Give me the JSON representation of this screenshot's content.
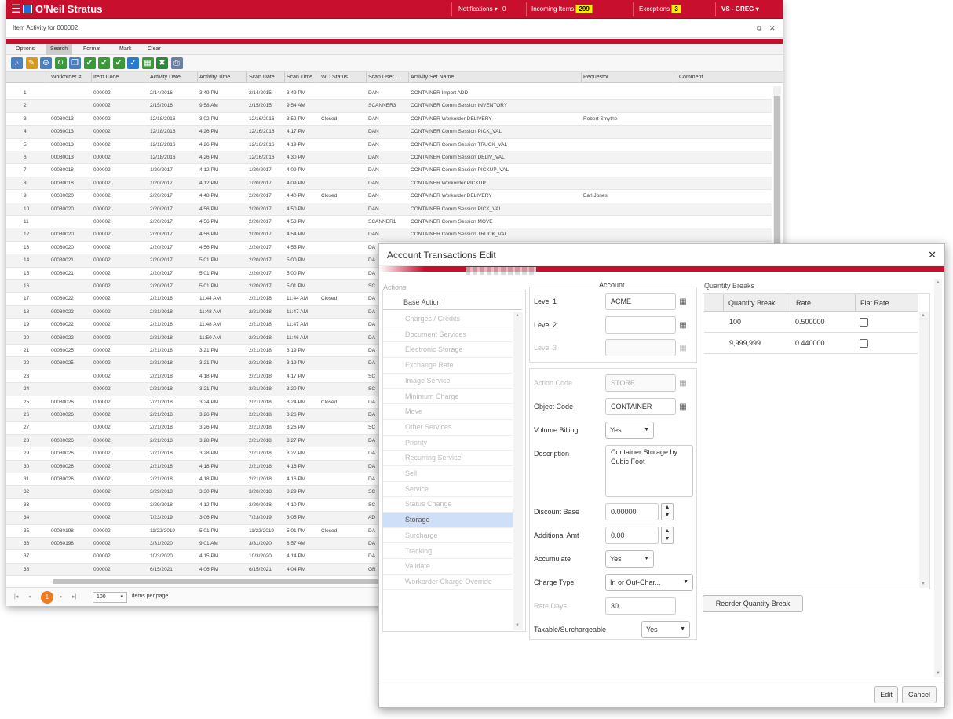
{
  "app": {
    "name": "O'Neil Stratus",
    "notifications_label": "Notifications",
    "notifications_count": "0",
    "incoming_label": "Incoming Items",
    "incoming_count": "299",
    "exceptions_label": "Exceptions",
    "exceptions_count": "3",
    "user_label": "VS - GREG"
  },
  "subtitle": "Item Activity for 000002",
  "tabs": [
    "Options",
    "Search",
    "Format",
    "Mark",
    "Clear"
  ],
  "active_tab": "Search",
  "columns": [
    "Workorder #",
    "Item Code",
    "Activity Date",
    "Activity Time",
    "Scan Date",
    "Scan Time",
    "WO Status",
    "Scan User ...",
    "Activity Set Name",
    "Requestor",
    "Comment"
  ],
  "rows": [
    [
      "1",
      "",
      "000002",
      "2/14/2016",
      "3:49 PM",
      "2/14/2015",
      "3:49 PM",
      "",
      "DAN",
      "CONTAINER Import ADD",
      "",
      ""
    ],
    [
      "2",
      "",
      "000002",
      "2/15/2016",
      "9:58 AM",
      "2/15/2015",
      "9:54 AM",
      "",
      "SCANNER3",
      "CONTAINER Comm Session INVENTORY",
      "",
      ""
    ],
    [
      "3",
      "00080013",
      "000002",
      "12/18/2016",
      "3:02 PM",
      "12/16/2016",
      "3:52 PM",
      "Closed",
      "DAN",
      "CONTAINER Workorder DELIVERY",
      "Robert Smythe",
      ""
    ],
    [
      "4",
      "00080013",
      "000002",
      "12/18/2016",
      "4:26 PM",
      "12/16/2016",
      "4:17 PM",
      "",
      "DAN",
      "CONTAINER Comm Session PICK_VAL",
      "",
      ""
    ],
    [
      "5",
      "00080013",
      "000002",
      "12/18/2016",
      "4:26 PM",
      "12/16/2016",
      "4:19 PM",
      "",
      "DAN",
      "CONTAINER Comm Session TRUCK_VAL",
      "",
      ""
    ],
    [
      "6",
      "00080013",
      "000002",
      "12/18/2016",
      "4:26 PM",
      "12/16/2016",
      "4:30 PM",
      "",
      "DAN",
      "CONTAINER Comm Session DELIV_VAL",
      "",
      ""
    ],
    [
      "7",
      "00080018",
      "000002",
      "1/20/2017",
      "4:12 PM",
      "1/20/2017",
      "4:09 PM",
      "",
      "DAN",
      "CONTAINER Comm Session PICKUP_VAL",
      "",
      ""
    ],
    [
      "8",
      "00080018",
      "000002",
      "1/20/2017",
      "4:12 PM",
      "1/20/2017",
      "4:09 PM",
      "",
      "DAN",
      "CONTAINER Workorder PICKUP",
      "",
      ""
    ],
    [
      "9",
      "00080020",
      "000002",
      "2/20/2017",
      "4:48 PM",
      "2/20/2017",
      "4:40 PM",
      "Closed",
      "DAN",
      "CONTAINER Workorder DELIVERY",
      "Earl Jones",
      ""
    ],
    [
      "10",
      "00080020",
      "000002",
      "2/20/2017",
      "4:56 PM",
      "2/20/2017",
      "4:50 PM",
      "",
      "DAN",
      "CONTAINER Comm Session PICK_VAL",
      "",
      ""
    ],
    [
      "11",
      "",
      "000002",
      "2/20/2017",
      "4:56 PM",
      "2/20/2017",
      "4:53 PM",
      "",
      "SCANNER1",
      "CONTAINER Comm Session MOVE",
      "",
      ""
    ],
    [
      "12",
      "00080020",
      "000002",
      "2/20/2017",
      "4:56 PM",
      "2/20/2017",
      "4:54 PM",
      "",
      "DAN",
      "CONTAINER Comm Session TRUCK_VAL",
      "",
      ""
    ],
    [
      "13",
      "00080020",
      "000002",
      "2/20/2017",
      "4:56 PM",
      "2/20/2017",
      "4:55 PM",
      "",
      "DA",
      "",
      "",
      ""
    ],
    [
      "14",
      "00080021",
      "000002",
      "2/20/2017",
      "5:01 PM",
      "2/20/2017",
      "5:00 PM",
      "",
      "DA",
      "",
      "",
      ""
    ],
    [
      "15",
      "00080021",
      "000002",
      "2/20/2017",
      "5:01 PM",
      "2/20/2017",
      "5:00 PM",
      "",
      "DA",
      "",
      "",
      ""
    ],
    [
      "16",
      "",
      "000002",
      "2/20/2017",
      "5:01 PM",
      "2/20/2017",
      "5:01 PM",
      "",
      "SC",
      "",
      "",
      ""
    ],
    [
      "17",
      "00080022",
      "000002",
      "2/21/2018",
      "11:44 AM",
      "2/21/2018",
      "11:44 AM",
      "Closed",
      "DA",
      "",
      "",
      ""
    ],
    [
      "18",
      "00080022",
      "000002",
      "2/21/2018",
      "11:48 AM",
      "2/21/2018",
      "11:47 AM",
      "",
      "DA",
      "",
      "",
      ""
    ],
    [
      "19",
      "00080022",
      "000002",
      "2/21/2018",
      "11:48 AM",
      "2/21/2018",
      "11:47 AM",
      "",
      "DA",
      "",
      "",
      ""
    ],
    [
      "20",
      "00080022",
      "000002",
      "2/21/2018",
      "11:50 AM",
      "2/21/2018",
      "11:46 AM",
      "",
      "DA",
      "",
      "",
      ""
    ],
    [
      "21",
      "00080025",
      "000002",
      "2/21/2018",
      "3:21 PM",
      "2/21/2018",
      "3:19 PM",
      "",
      "DA",
      "",
      "",
      ""
    ],
    [
      "22",
      "00080025",
      "000002",
      "2/21/2018",
      "3:21 PM",
      "2/21/2018",
      "3:19 PM",
      "",
      "DA",
      "",
      "",
      ""
    ],
    [
      "23",
      "",
      "000002",
      "2/21/2018",
      "4:18 PM",
      "2/21/2018",
      "4:17 PM",
      "",
      "SC",
      "",
      "",
      ""
    ],
    [
      "24",
      "",
      "000002",
      "2/21/2018",
      "3:21 PM",
      "2/21/2018",
      "3:20 PM",
      "",
      "SC",
      "",
      "",
      ""
    ],
    [
      "25",
      "00080026",
      "000002",
      "2/21/2018",
      "3:24 PM",
      "2/21/2018",
      "3:24 PM",
      "Closed",
      "DA",
      "",
      "",
      ""
    ],
    [
      "26",
      "00080026",
      "000002",
      "2/21/2018",
      "3:26 PM",
      "2/21/2018",
      "3:26 PM",
      "",
      "DA",
      "",
      "",
      ""
    ],
    [
      "27",
      "",
      "000002",
      "2/21/2018",
      "3:26 PM",
      "2/21/2018",
      "3:26 PM",
      "",
      "SC",
      "",
      "",
      ""
    ],
    [
      "28",
      "00080026",
      "000002",
      "2/21/2018",
      "3:28 PM",
      "2/21/2018",
      "3:27 PM",
      "",
      "DA",
      "",
      "",
      ""
    ],
    [
      "29",
      "00080026",
      "000002",
      "2/21/2018",
      "3:28 PM",
      "2/21/2018",
      "3:27 PM",
      "",
      "DA",
      "",
      "",
      ""
    ],
    [
      "30",
      "00080026",
      "000002",
      "2/21/2018",
      "4:18 PM",
      "2/21/2018",
      "4:16 PM",
      "",
      "DA",
      "",
      "",
      ""
    ],
    [
      "31",
      "00080026",
      "000002",
      "2/21/2018",
      "4:18 PM",
      "2/21/2018",
      "4:16 PM",
      "",
      "DA",
      "",
      "",
      ""
    ],
    [
      "32",
      "",
      "000002",
      "3/29/2018",
      "3:30 PM",
      "3/20/2018",
      "3:29 PM",
      "",
      "SC",
      "",
      "",
      ""
    ],
    [
      "33",
      "",
      "000002",
      "3/29/2018",
      "4:12 PM",
      "3/20/2018",
      "4:10 PM",
      "",
      "SC",
      "",
      "",
      ""
    ],
    [
      "34",
      "",
      "000002",
      "7/23/2019",
      "3:06 PM",
      "7/23/2019",
      "3:05 PM",
      "",
      "AD",
      "",
      "",
      ""
    ],
    [
      "35",
      "00080198",
      "000002",
      "11/22/2019",
      "5:01 PM",
      "11/22/2019",
      "5:01 PM",
      "Closed",
      "DA",
      "",
      "",
      ""
    ],
    [
      "36",
      "00080198",
      "000002",
      "3/31/2020",
      "9:01 AM",
      "3/31/2020",
      "8:57 AM",
      "",
      "DA",
      "",
      "",
      ""
    ],
    [
      "37",
      "",
      "000002",
      "10/3/2020",
      "4:15 PM",
      "10/3/2020",
      "4:14 PM",
      "",
      "DA",
      "",
      "",
      ""
    ],
    [
      "38",
      "",
      "000002",
      "6/15/2021",
      "4:06 PM",
      "6/15/2021",
      "4:04 PM",
      "",
      "GR",
      "",
      "",
      ""
    ]
  ],
  "pager": {
    "current": "1",
    "page_size": "100",
    "label": "items per page"
  },
  "dialog": {
    "title": "Account Transactions Edit",
    "actions_legend": "Actions",
    "base_action_header": "Base Action",
    "actions": [
      "Charges / Credits",
      "Document Services",
      "Electronic Storage",
      "Exchange Rate",
      "Image Service",
      "Minimum Charge",
      "Move",
      "Other Services",
      "Priority",
      "Recurring Service",
      "Sell",
      "Service",
      "Status Change",
      "Storage",
      "Surcharge",
      "Tracking",
      "Validate",
      "Workorder Charge Override"
    ],
    "selected_action": "Storage",
    "account_legend": "Account",
    "level1_label": "Level 1",
    "level1_value": "ACME",
    "level2_label": "Level 2",
    "level2_value": "",
    "level3_label": "Level 3",
    "level3_value": "",
    "action_code_label": "Action Code",
    "action_code_value": "STORE",
    "object_code_label": "Object Code",
    "object_code_value": "CONTAINER",
    "volume_billing_label": "Volume Billing",
    "volume_billing_value": "Yes",
    "description_label": "Description",
    "description_value": "Container Storage by Cubic Foot",
    "discount_base_label": "Discount Base",
    "discount_base_value": "0.00000",
    "additional_amt_label": "Additional Amt",
    "additional_amt_value": "0.00",
    "accumulate_label": "Accumulate",
    "accumulate_value": "Yes",
    "charge_type_label": "Charge Type",
    "charge_type_value": "In or Out-Char...",
    "rate_days_label": "Rate Days",
    "rate_days_value": "30",
    "taxable_label": "Taxable/Surchargeable",
    "taxable_value": "Yes",
    "qb_legend": "Quantity Breaks",
    "qb_headers": [
      "Quantity Break",
      "Rate",
      "Flat Rate"
    ],
    "qb_rows": [
      [
        "100",
        "0.500000"
      ],
      [
        "9,999,999",
        "0.440000"
      ]
    ],
    "reorder_label": "Reorder Quantity Break",
    "edit_label": "Edit",
    "cancel_label": "Cancel"
  },
  "colors": {
    "brand": "#c8102e",
    "badge": "#ffec00",
    "selected": "#cfdff7",
    "pager_current": "#f07b1a"
  }
}
